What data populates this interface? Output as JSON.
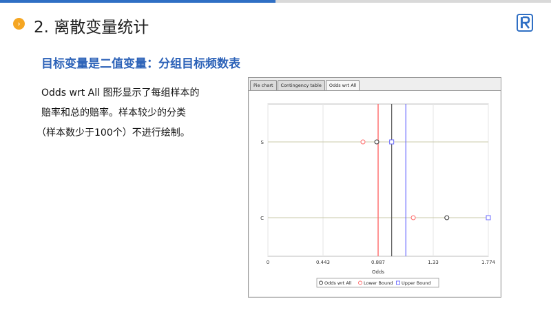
{
  "header": {
    "bullet_glyph": "›",
    "title": "2. 离散变量统计"
  },
  "subtitle": "目标变量是二值变量：分组目标频数表",
  "description": {
    "line1": "Odds wrt All 图形显示了每组样本的",
    "line2": "赔率和总的赔率。样本较少的分类",
    "line3": "（样本数少于100个）不进行绘制。"
  },
  "tabs": [
    {
      "label": "Pie chart",
      "active": false
    },
    {
      "label": "Contingency table",
      "active": false
    },
    {
      "label": "Odds wrt All",
      "active": true
    }
  ],
  "colors": {
    "accent": "#2f6fc4",
    "bullet": "#f5a623",
    "odds": "#333333",
    "lower": "#ff6666",
    "upper": "#6b6bff",
    "overall": "#555555"
  },
  "chart_data": {
    "type": "scatter",
    "xlabel": "Odds",
    "xticks": [
      "0",
      "0.443",
      "0.887",
      "1.33",
      "1.774"
    ],
    "xlim": [
      0,
      1.774
    ],
    "categories": [
      "S",
      "C"
    ],
    "overall_lines": {
      "lower": 0.887,
      "odds": 0.996,
      "upper": 1.11
    },
    "series": [
      {
        "name": "Odds wrt All",
        "marker": "circle",
        "values": [
          0.876,
          1.44
        ]
      },
      {
        "name": "Lower Bound",
        "marker": "circle",
        "values": [
          0.765,
          1.17
        ]
      },
      {
        "name": "Upper Bound",
        "marker": "square",
        "values": [
          0.996,
          1.774
        ]
      }
    ]
  }
}
